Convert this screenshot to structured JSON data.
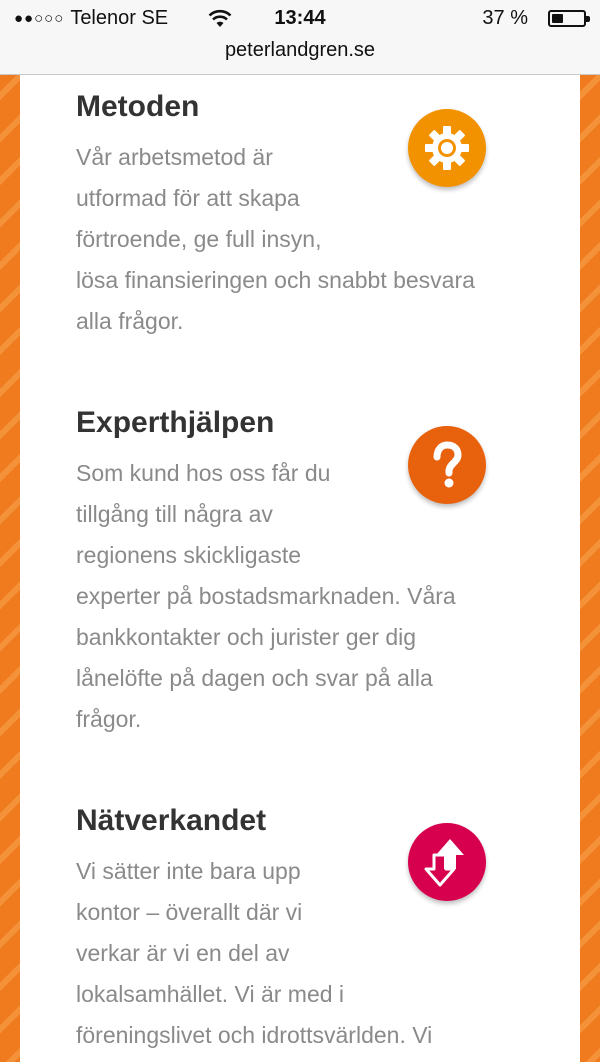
{
  "status_bar": {
    "signal": "●●○○○",
    "carrier": "Telenor SE",
    "time": "13:44",
    "battery_percent": "37 %",
    "battery_level": 0.37
  },
  "browser": {
    "url": "peterlandgren.se"
  },
  "colors": {
    "accent": "#f07a1e",
    "gear": "#f39200",
    "question": "#e8620e",
    "network": "#d6004f"
  },
  "sections": [
    {
      "title": "Metoden",
      "icon": "gear-icon",
      "lines": [
        "Vår arbetsmetod är",
        "utformad för att skapa",
        "förtroende, ge full insyn,",
        "lösa finansieringen och snabbt besvara",
        "alla frågor."
      ]
    },
    {
      "title": "Experthjälpen",
      "icon": "question-icon",
      "lines": [
        "Som kund hos oss får du",
        "tillgång till några av",
        "regionens skickligaste",
        "experter på bostadsmarknaden. Våra",
        "bankkontakter och jurister ger dig",
        "lånelöfte på dagen och svar på alla",
        "frågor."
      ]
    },
    {
      "title": "Nätverkandet",
      "icon": "arrows-up-down-icon",
      "lines": [
        "Vi sätter inte bara upp",
        "kontor – överallt där vi",
        "verkar är vi en del av",
        "lokalsamhället. Vi är med i",
        "föreningslivet och idrottsvärlden. Vi"
      ]
    }
  ]
}
